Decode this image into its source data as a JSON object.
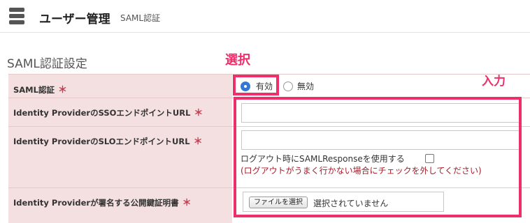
{
  "header": {
    "icon": "server-stack-icon",
    "title": "ユーザー管理",
    "subtitle": "SAML認証"
  },
  "section": {
    "title": "SAML認証設定"
  },
  "annotations": {
    "select": "選択",
    "input": "入力",
    "color": "#ef2f6a"
  },
  "form": {
    "required_mark": "＊",
    "saml_auth": {
      "label": "SAML認証",
      "options": [
        {
          "label": "有効",
          "selected": true
        },
        {
          "label": "無効",
          "selected": false
        }
      ]
    },
    "sso_url": {
      "label": "Identity ProviderのSSOエンドポイントURL",
      "value": ""
    },
    "slo_url": {
      "label": "Identity ProviderのSLOエンドポイントURL",
      "value": "",
      "logout_checkbox_label": "ログアウト時にSAMLResponseを使用する",
      "logout_checked": false,
      "note": "(ログアウトがうまく行かない場合にチェックを外してください)"
    },
    "certificate": {
      "label": "Identity Providerが署名する公開鍵証明書",
      "button_label": "ファイルを選択",
      "status": "選択されていません"
    }
  },
  "colors": {
    "label_bg": "#f4e0e0",
    "required": "#c9384b",
    "note": "#a61c28",
    "radio_selected": "#3478d6"
  }
}
